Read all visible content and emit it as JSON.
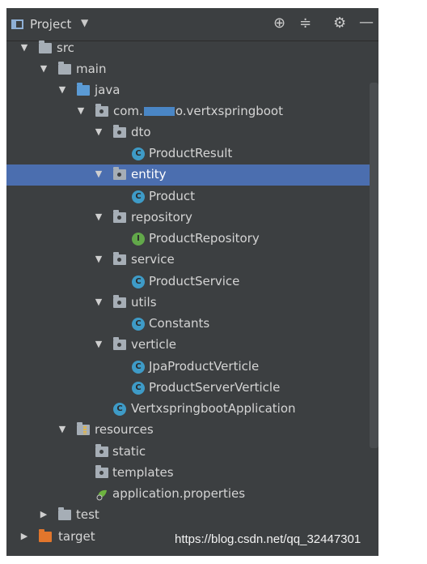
{
  "header": {
    "title": "Project",
    "caret": "▼",
    "tools": [
      "⊕",
      "≑",
      "⚙",
      "—"
    ]
  },
  "tree": {
    "src": "src",
    "main": "main",
    "java": "java",
    "com_prefix": "com.",
    "com_suffix": "o.vertxspringboot",
    "dto": "dto",
    "product_result": "ProductResult",
    "entity": "entity",
    "product": "Product",
    "repository": "repository",
    "product_repository": "ProductRepository",
    "service": "service",
    "product_service": "ProductService",
    "utils": "utils",
    "constants": "Constants",
    "verticle": "verticle",
    "jpa_product_verticle": "JpaProductVerticle",
    "product_server_verticle": "ProductServerVerticle",
    "app": "VertxspringbootApplication",
    "resources": "resources",
    "static": "static",
    "templates": "templates",
    "app_props": "application.properties",
    "test": "test",
    "target": "target"
  },
  "badges": {
    "class": "C",
    "interface": "I"
  },
  "watermark": "https://blog.csdn.net/qq_32447301",
  "colors": {
    "panel": "#3c3f41",
    "selected": "#4b6eaf",
    "class_badge": "#3e9bc7",
    "interface_badge": "#62a84a",
    "source_folder": "#5b9bd5",
    "excluded_folder": "#e2762c"
  }
}
